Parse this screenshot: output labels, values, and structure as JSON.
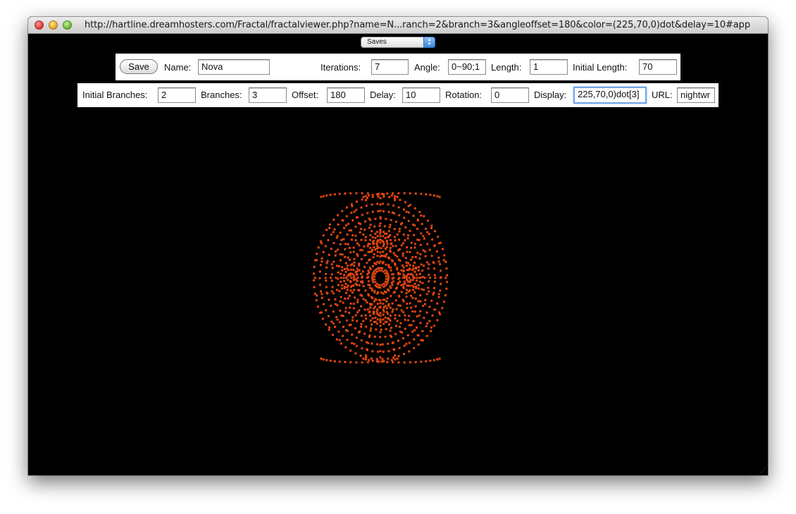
{
  "window": {
    "title": "http://hartline.dreamhosters.com/Fractal/fractalviewer.php?name=N...ranch=2&branch=3&angleoffset=180&color=(225,70,0)dot&delay=10#app"
  },
  "saves": {
    "label": "Saves"
  },
  "toolbar1": {
    "save_label": "Save",
    "name_label": "Name:",
    "name_value": "Nova",
    "iterations_label": "Iterations:",
    "iterations_value": "7",
    "angle_label": "Angle:",
    "angle_value": "0~90;1",
    "length_label": "Length:",
    "length_value": "1",
    "initial_length_label": "Initial Length:",
    "initial_length_value": "70"
  },
  "toolbar2": {
    "initial_branches_label": "Initial Branches:",
    "initial_branches_value": "2",
    "branches_label": "Branches:",
    "branches_value": "3",
    "offset_label": "Offset:",
    "offset_value": "180",
    "delay_label": "Delay:",
    "delay_value": "10",
    "rotation_label": "Rotation:",
    "rotation_value": "0",
    "display_label": "Display:",
    "display_value": "225,70,0)dot[3]",
    "url_label": "URL:",
    "url_value": "nightwr"
  },
  "fractal": {
    "dot_color": "#e1460f",
    "background": "#000000"
  }
}
